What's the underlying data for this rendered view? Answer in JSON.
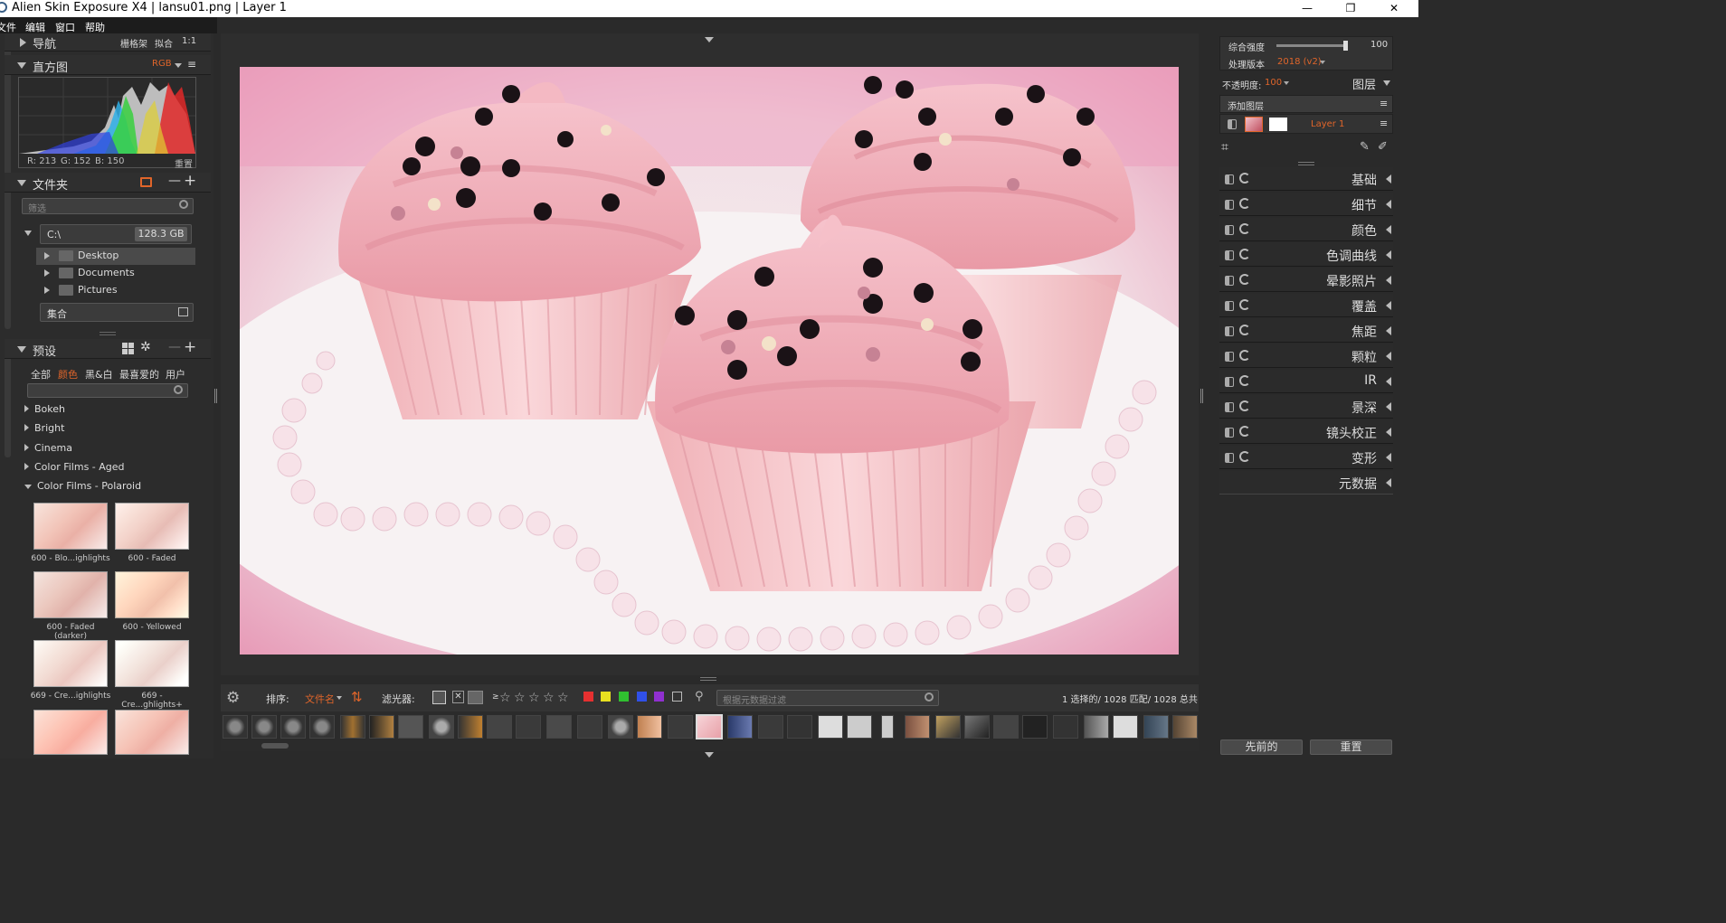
{
  "window": {
    "title": "Alien Skin Exposure X4 | lansu01.png | Layer 1",
    "minimize_glyph": "—",
    "maximize_glyph": "❐",
    "close_glyph": "✕"
  },
  "menu": [
    "文件",
    "编辑",
    "窗口",
    "帮助"
  ],
  "navigator": {
    "title": "导航",
    "opt1": "栅格架",
    "opt2": "拟合",
    "opt3": "1:1"
  },
  "histogram": {
    "title": "直方图",
    "mode": "RGB",
    "r": "R: 213",
    "g": "G: 152",
    "b": "B: 150",
    "reset": "重置"
  },
  "folders": {
    "title": "文件夹",
    "filter_placeholder": "筛选",
    "drive": "C:\\",
    "drive_size": "128.3 GB",
    "items": [
      "Desktop",
      "Documents",
      "Pictures"
    ],
    "collections": "集合"
  },
  "presets": {
    "title": "预设",
    "tabs": [
      "全部",
      "颜色",
      "黑&白",
      "最喜爱的",
      "用户"
    ],
    "active_tab": "颜色",
    "categories": [
      "Bokeh",
      "Bright",
      "Cinema",
      "Color Films - Aged",
      "Color Films - Polaroid"
    ],
    "thumbs": [
      "600 - Blo...ighlights",
      "600 - Faded",
      "600 - Faded (darker)",
      "600 - Yellowed",
      "669 - Cre...ighlights",
      "669 - Cre...ghlights+"
    ]
  },
  "filterbar": {
    "sort_label": "排序:",
    "sort_value": "文件名",
    "filter_label": "滤光器:",
    "rating_ge": "≥",
    "meta_placeholder": "根据元数据过滤",
    "status": "1 选择的/ 1028 匹配/ 1028 总共",
    "color_swatches": [
      "#e53030",
      "#e8e020",
      "#30c030",
      "#3050e8",
      "#9030d0"
    ]
  },
  "right": {
    "intensity_label": "综合强度",
    "intensity_value": "100",
    "version_label": "处理版本",
    "version_value": "2018 (v2)",
    "opacity_label": "不透明度:",
    "opacity_value": "100",
    "layers_label": "图层",
    "add_layer": "添加图层",
    "layer_name": "Layer 1",
    "panels": [
      "基础",
      "细节",
      "颜色",
      "色调曲线",
      "晕影照片",
      "覆盖",
      "焦距",
      "颗粒",
      "IR",
      "景深",
      "镜头校正",
      "变形",
      "元数据"
    ],
    "prev_button": "先前的",
    "reset_button": "重置"
  },
  "colors": {
    "accent": "#e0652a",
    "panel": "#2c2c2c",
    "photo_pink": "#f2b3bd"
  }
}
